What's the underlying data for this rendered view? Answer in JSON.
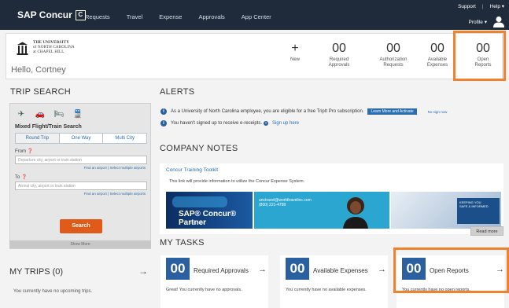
{
  "topbar": {
    "logo_text": "SAP Concur",
    "logo_mark": "C",
    "nav": [
      "Requests",
      "Travel",
      "Expense",
      "Approvals",
      "App Center"
    ],
    "support": "Support",
    "help": "Help ▾",
    "profile": "Profile ▾"
  },
  "header": {
    "org_line1": "THE UNIVERSITY",
    "org_line2": "of NORTH CAROLINA",
    "org_line3": "at CHAPEL HILL",
    "greeting": "Hello, Cortney",
    "new_label": "New",
    "new_symbol": "+",
    "stats": [
      {
        "value": "00",
        "label_1": "Required",
        "label_2": "Approvals"
      },
      {
        "value": "00",
        "label_1": "Authorization",
        "label_2": "Requests"
      },
      {
        "value": "00",
        "label_1": "Available",
        "label_2": "Expenses"
      },
      {
        "value": "00",
        "label_1": "Open",
        "label_2": "Reports"
      }
    ]
  },
  "trip_search": {
    "title": "TRIP SEARCH",
    "subtitle": "Mixed Flight/Train Search",
    "tabs": [
      "Round Trip",
      "One Way",
      "Multi City"
    ],
    "from_label": "From",
    "from_placeholder": "Departure city, airport or train station",
    "to_label": "To",
    "to_placeholder": "Arrival city, airport or train station",
    "links": "Find an airport  |  Select multiple airports",
    "search_button": "Search",
    "show_more": "Show More"
  },
  "my_trips": {
    "title": "MY TRIPS (0)",
    "empty": "You currently have no upcoming trips."
  },
  "alerts": {
    "title": "ALERTS",
    "alert1": "As a University of North Carolina employee, you are eligible for a free TripIt Pro subscription.",
    "alert1_button": "Learn More and Activate",
    "alert1_link": "No sign now",
    "alert2": "You haven't signed up to receive e-receipts.",
    "alert2_link": "Sign up here"
  },
  "company_notes": {
    "title": "COMPANY NOTES",
    "link": "Concur Training Toolkit",
    "desc": "This link will provide information to utilize the Concur Expense System.",
    "banner1_title": "SAP® Concur® Partner",
    "banner1_sub": "TMC Elite",
    "banner2_line1": "unctravel@worldtravelinc.com",
    "banner2_line2": "(800) 221-4798",
    "banner3_line1": "KEEPING YOU",
    "banner3_line2": "SAFE & INFORMED",
    "read_more": "Read more"
  },
  "my_tasks": {
    "title": "MY TASKS",
    "cards": [
      {
        "value": "00",
        "label": "Required Approvals",
        "desc": "Great! You currently have no approvals."
      },
      {
        "value": "00",
        "label": "Available Expenses",
        "desc": "You currently have no available expenses."
      },
      {
        "value": "00",
        "label": "Open Reports",
        "desc": "You currently have no open reports."
      }
    ]
  },
  "colors": {
    "accent": "#2a5fa0",
    "highlight": "#f0822e",
    "topbar": "#1f2a3a",
    "search": "#e05a1a"
  }
}
